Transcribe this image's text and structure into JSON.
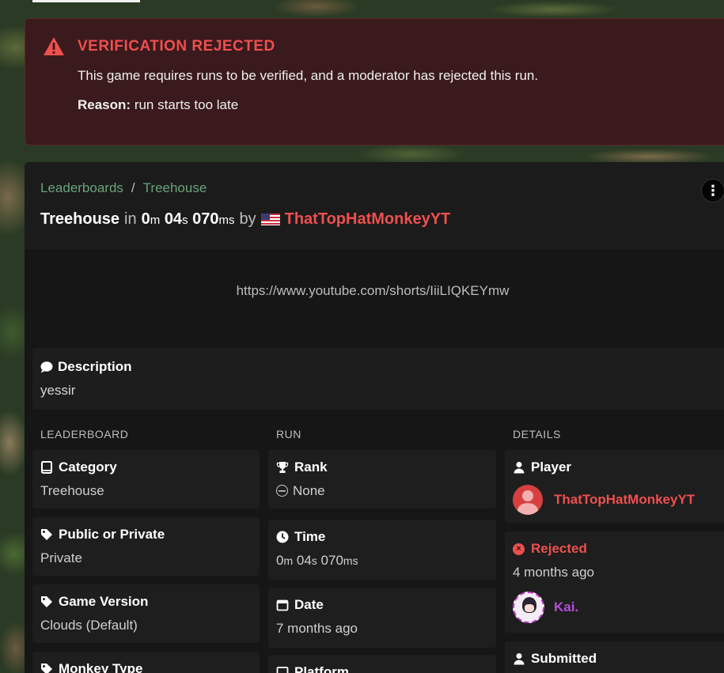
{
  "alert": {
    "title": "VERIFICATION REJECTED",
    "body": "This game requires runs to be verified, and a moderator has rejected this run.",
    "reason_label": "Reason:",
    "reason_text": "run starts too late"
  },
  "breadcrumb": {
    "items": [
      "Leaderboards",
      "Treehouse"
    ],
    "separator": "/"
  },
  "run_title": {
    "game": "Treehouse",
    "in": "in",
    "time_m": "0",
    "unit_m": "m",
    "time_s": "04",
    "unit_s": "s",
    "time_ms": "070",
    "unit_ms": "ms",
    "by": "by",
    "runner": "ThatTopHatMonkeyYT"
  },
  "video": {
    "url": "https://www.youtube.com/shorts/IiiLIQKEYmw"
  },
  "description": {
    "label": "Description",
    "text": "yessir"
  },
  "columns": {
    "leaderboard": "LEADERBOARD",
    "run": "RUN",
    "details": "DETAILS"
  },
  "leaderboard": {
    "category_label": "Category",
    "category_value": "Treehouse",
    "public_label": "Public or Private",
    "public_value": "Private",
    "version_label": "Game Version",
    "version_value": "Clouds (Default)",
    "monkey_label": "Monkey Type"
  },
  "run": {
    "rank_label": "Rank",
    "rank_value": "None",
    "time_label": "Time",
    "time_m": "0",
    "unit_m": "m",
    "time_s": "04",
    "unit_s": "s",
    "time_ms": "070",
    "unit_ms": "ms",
    "date_label": "Date",
    "date_value": "7 months ago",
    "platform_label": "Platform"
  },
  "details": {
    "player_label": "Player",
    "player_name": "ThatTopHatMonkeyYT",
    "status_label": "Rejected",
    "status_time": "4 months ago",
    "moderator_name": "Kai.",
    "submitted_label": "Submitted"
  },
  "colors": {
    "accent_red": "#ef4f4f",
    "link_green": "#6aa37a",
    "moderator_purple": "#b34fd6"
  }
}
